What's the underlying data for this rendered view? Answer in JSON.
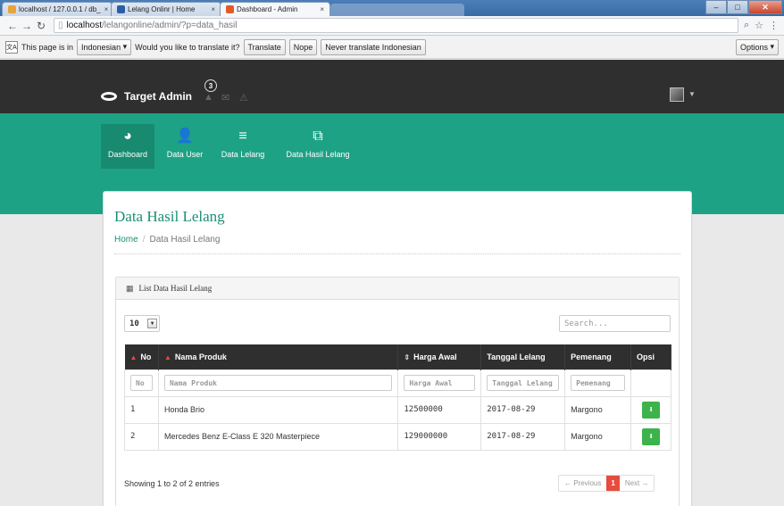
{
  "browser": {
    "tabs": [
      {
        "title": "localhost / 127.0.0.1 / db_",
        "favicon_color": "#e8a33c"
      },
      {
        "title": "Lelang Onlinr | Home",
        "favicon_color": "#2b5ea8"
      },
      {
        "title": "Dashboard - Admin",
        "favicon_color": "#e25b2a"
      }
    ],
    "address": {
      "host": "localhost",
      "path": "/lelangonline/admin/?p=data_hasil"
    }
  },
  "translate_bar": {
    "prefix": "This page is in",
    "language": "Indonesian",
    "question": "Would you like to translate it?",
    "translate_label": "Translate",
    "nope_label": "Nope",
    "never_label": "Never translate Indonesian",
    "options_label": "Options"
  },
  "header": {
    "brand": "Target Admin",
    "notification_count": "3"
  },
  "menu": [
    {
      "label": "Dashboard",
      "icon": "dashboard-icon",
      "glyph": "◕"
    },
    {
      "label": "Data User",
      "icon": "user-icon",
      "glyph": "👤"
    },
    {
      "label": "Data Lelang",
      "icon": "list-icon",
      "glyph": "≡"
    },
    {
      "label": "Data Hasil Lelang",
      "icon": "copy-icon",
      "glyph": "⧉"
    }
  ],
  "page": {
    "title": "Data Hasil Lelang",
    "breadcrumb": {
      "home": "Home",
      "current": "Data Hasil Lelang"
    }
  },
  "panel": {
    "title": "List Data Hasil Lelang",
    "page_length": "10",
    "search_placeholder": "Search...",
    "columns": [
      "No",
      "Nama Produk",
      "Harga Awal",
      "Tanggal Lelang",
      "Pemenang",
      "Opsi"
    ],
    "filters": [
      "No",
      "Nama Produk",
      "Harga Awal",
      "Tanggal Lelang",
      "Pemenang"
    ],
    "rows": [
      {
        "no": "1",
        "produk": "Honda Brio",
        "harga": "12500000",
        "tanggal": "2017-08-29",
        "pemenang": "Margono"
      },
      {
        "no": "2",
        "produk": "Mercedes Benz E-Class E 320 Masterpiece",
        "harga": "129000000",
        "tanggal": "2017-08-29",
        "pemenang": "Margono"
      }
    ],
    "info": "Showing 1 to 2 of 2 entries",
    "pager": {
      "previous": "← Previous",
      "current": "1",
      "next": "Next →"
    }
  },
  "colors": {
    "accent": "#1ea285",
    "header": "#2f2f2f",
    "pager_active": "#e74c3c",
    "action_button": "#3cb34b"
  }
}
